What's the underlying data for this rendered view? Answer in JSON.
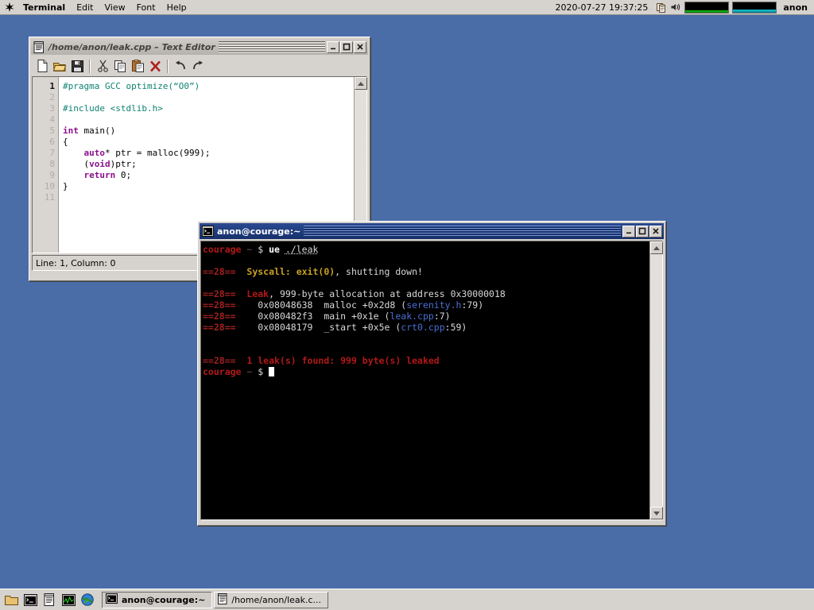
{
  "desktop": {
    "background_color": "#4a6da7"
  },
  "menubar": {
    "logo_icon": "serenity-logo-icon",
    "items": [
      {
        "label": "Terminal",
        "bold": true
      },
      {
        "label": "Edit",
        "bold": false
      },
      {
        "label": "View",
        "bold": false
      },
      {
        "label": "Font",
        "bold": false
      },
      {
        "label": "Help",
        "bold": false
      }
    ],
    "clock": "2020-07-27 19:37:25",
    "tray": [
      {
        "icon": "clipboard-icon",
        "name": "clipboard-history"
      },
      {
        "icon": "speaker-icon",
        "name": "audio-volume"
      }
    ],
    "graphs": [
      {
        "name": "cpu-graph",
        "color": "#11c511",
        "level": 18
      },
      {
        "name": "memory-graph",
        "color": "#15c5d6",
        "level": 26
      }
    ],
    "username": "anon"
  },
  "editor_window": {
    "title": "/home/anon/leak.cpp – Text Editor",
    "icon": "text-editor-icon",
    "buttons": {
      "minimize": "–",
      "maximize": "□",
      "close": "✕"
    },
    "toolbar": [
      {
        "name": "new-file-button",
        "icon": "new-file-icon"
      },
      {
        "name": "open-file-button",
        "icon": "open-folder-icon"
      },
      {
        "name": "save-file-button",
        "icon": "save-disk-icon"
      },
      {
        "name": "separator-1",
        "icon": "separator"
      },
      {
        "name": "cut-button",
        "icon": "scissors-icon"
      },
      {
        "name": "copy-button",
        "icon": "copy-icon"
      },
      {
        "name": "paste-button",
        "icon": "clipboard-paste-icon"
      },
      {
        "name": "delete-button",
        "icon": "red-x-icon"
      },
      {
        "name": "separator-2",
        "icon": "separator"
      },
      {
        "name": "undo-button",
        "icon": "undo-arrow-icon"
      },
      {
        "name": "redo-button",
        "icon": "redo-arrow-icon"
      }
    ],
    "line_numbers": [
      "1",
      "2",
      "3",
      "4",
      "5",
      "6",
      "7",
      "8",
      "9",
      "10",
      "11"
    ],
    "current_line": 1,
    "code_lines": [
      {
        "n": 1,
        "current": true,
        "tokens": [
          {
            "t": "#pragma GCC optimize(“O0”)",
            "c": "pre"
          }
        ]
      },
      {
        "n": 2,
        "current": false,
        "tokens": []
      },
      {
        "n": 3,
        "current": false,
        "tokens": [
          {
            "t": "#include <stdlib.h>",
            "c": "pre"
          }
        ]
      },
      {
        "n": 4,
        "current": false,
        "tokens": []
      },
      {
        "n": 5,
        "current": false,
        "tokens": [
          {
            "t": "int",
            "c": "kw"
          },
          {
            "t": " main()",
            "c": "id"
          }
        ]
      },
      {
        "n": 6,
        "current": false,
        "tokens": [
          {
            "t": "{",
            "c": "op"
          }
        ]
      },
      {
        "n": 7,
        "current": false,
        "tokens": [
          {
            "t": "    ",
            "c": "op"
          },
          {
            "t": "auto",
            "c": "kw"
          },
          {
            "t": "* ptr = malloc(999);",
            "c": "id"
          }
        ]
      },
      {
        "n": 8,
        "current": false,
        "tokens": [
          {
            "t": "    (",
            "c": "op"
          },
          {
            "t": "void",
            "c": "kw"
          },
          {
            "t": ")ptr;",
            "c": "id"
          }
        ]
      },
      {
        "n": 9,
        "current": false,
        "tokens": [
          {
            "t": "    ",
            "c": "op"
          },
          {
            "t": "return",
            "c": "kw"
          },
          {
            "t": " 0;",
            "c": "id"
          }
        ]
      },
      {
        "n": 10,
        "current": false,
        "tokens": [
          {
            "t": "}",
            "c": "op"
          }
        ]
      },
      {
        "n": 11,
        "current": false,
        "tokens": []
      }
    ],
    "status": "Line: 1, Column: 0",
    "scrollbar": {
      "up_arrow": "scroll-up-icon",
      "down_arrow": "scroll-down-icon"
    }
  },
  "terminal_window": {
    "title": "anon@courage:~",
    "icon": "terminal-icon",
    "buttons": {
      "minimize": "–",
      "maximize": "□",
      "close": "✕"
    },
    "lines": [
      {
        "spans": [
          {
            "t": "courage",
            "c": "red"
          },
          {
            "t": " ~ ",
            "c": "gray"
          },
          {
            "t": "$ ",
            "c": "white"
          },
          {
            "t": "ue",
            "c": "bwhite"
          },
          {
            "t": " ",
            "c": "white"
          },
          {
            "t": "./leak",
            "c": "white ul"
          }
        ]
      },
      {
        "spans": []
      },
      {
        "spans": [
          {
            "t": "==28==  ",
            "c": "dkred"
          },
          {
            "t": "Syscall: exit(0)",
            "c": "orange"
          },
          {
            "t": ", shutting down!",
            "c": "white"
          }
        ]
      },
      {
        "spans": []
      },
      {
        "spans": [
          {
            "t": "==28==  ",
            "c": "dkred"
          },
          {
            "t": "Leak",
            "c": "red"
          },
          {
            "t": ", 999-byte allocation at address 0x30000018",
            "c": "white"
          }
        ]
      },
      {
        "spans": [
          {
            "t": "==28==    ",
            "c": "dkred"
          },
          {
            "t": "0x08048638  malloc +0x2d8 (",
            "c": "white"
          },
          {
            "t": "serenity.h",
            "c": "blue"
          },
          {
            "t": ":79)",
            "c": "white"
          }
        ]
      },
      {
        "spans": [
          {
            "t": "==28==    ",
            "c": "dkred"
          },
          {
            "t": "0x080482f3  main +0x1e (",
            "c": "white"
          },
          {
            "t": "leak.cpp",
            "c": "blue"
          },
          {
            "t": ":7)",
            "c": "white"
          }
        ]
      },
      {
        "spans": [
          {
            "t": "==28==    ",
            "c": "dkred"
          },
          {
            "t": "0x08048179  _start +0x5e (",
            "c": "white"
          },
          {
            "t": "crt0.cpp",
            "c": "blue"
          },
          {
            "t": ":59)",
            "c": "white"
          }
        ]
      },
      {
        "spans": []
      },
      {
        "spans": []
      },
      {
        "spans": [
          {
            "t": "==28==  ",
            "c": "dkred"
          },
          {
            "t": "1 leak(s) found: 999 byte(s) leaked",
            "c": "red"
          }
        ]
      },
      {
        "spans": [
          {
            "t": "courage",
            "c": "red"
          },
          {
            "t": " ~ ",
            "c": "gray"
          },
          {
            "t": "$ ",
            "c": "white"
          },
          {
            "t": "",
            "c": "cursor"
          }
        ]
      }
    ],
    "scrollbar": {
      "up_arrow": "scroll-up-icon",
      "down_arrow": "scroll-down-icon"
    }
  },
  "taskbar": {
    "quick_launch": [
      {
        "name": "file-manager-icon",
        "icon": "folder-icon"
      },
      {
        "name": "terminal-launcher-icon",
        "icon": "terminal-icon"
      },
      {
        "name": "text-editor-launcher-icon",
        "icon": "text-editor-icon"
      },
      {
        "name": "system-monitor-icon",
        "icon": "monitor-graph-icon"
      },
      {
        "name": "browser-icon",
        "icon": "globe-icon"
      }
    ],
    "windows": [
      {
        "label": "anon@courage:~",
        "icon": "terminal-icon",
        "active": true
      },
      {
        "label": "/home/anon/leak.c...",
        "icon": "text-editor-icon",
        "active": false
      }
    ]
  }
}
